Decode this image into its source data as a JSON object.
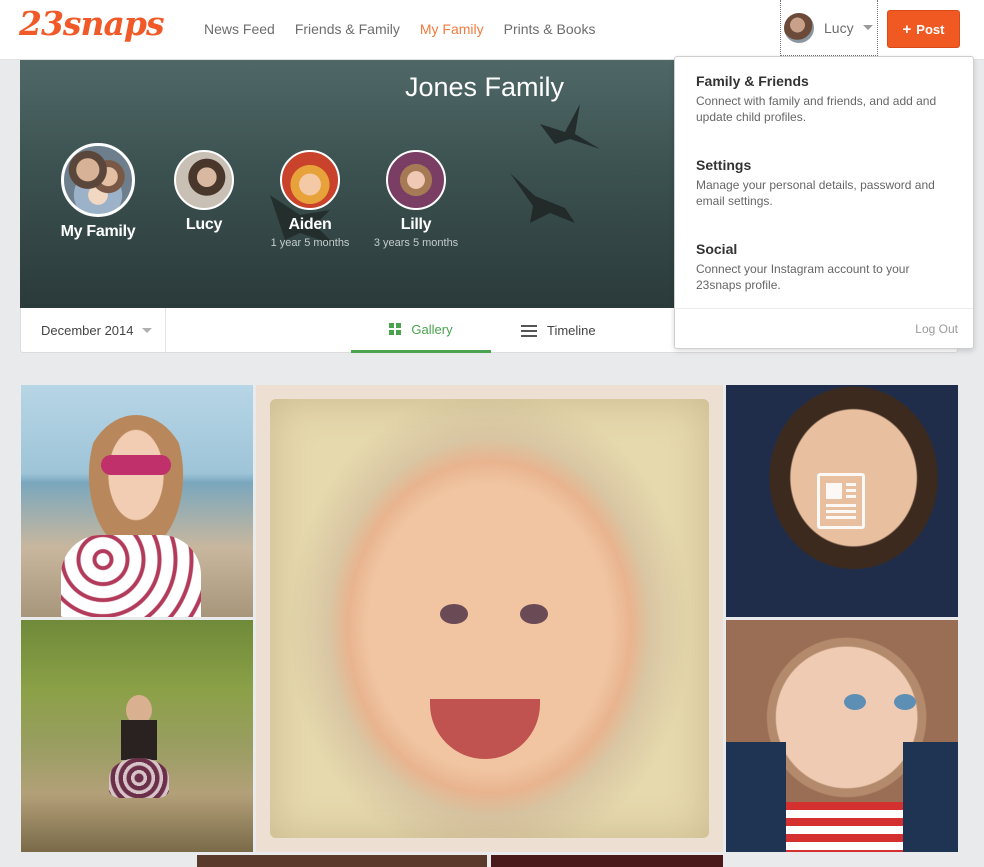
{
  "brand": {
    "logo": "23snaps",
    "accent": "#f05a22"
  },
  "nav": {
    "items": [
      {
        "label": "News Feed",
        "active": false
      },
      {
        "label": "Friends & Family",
        "active": false
      },
      {
        "label": "My Family",
        "active": true
      },
      {
        "label": "Prints & Books",
        "active": false
      }
    ]
  },
  "user": {
    "name": "Lucy"
  },
  "post_button": {
    "label": "Post",
    "icon": "plus-icon"
  },
  "hero": {
    "title": "Jones Family",
    "profiles": [
      {
        "name": "My Family",
        "age": ""
      },
      {
        "name": "Lucy",
        "age": ""
      },
      {
        "name": "Aiden",
        "age": "1 year 5 months"
      },
      {
        "name": "Lilly",
        "age": "3 years 5 months"
      }
    ]
  },
  "toolbar": {
    "month": "December 2014",
    "tabs": [
      {
        "label": "Gallery",
        "icon": "grid-icon",
        "active": true
      },
      {
        "label": "Timeline",
        "icon": "list-icon",
        "active": false
      }
    ]
  },
  "dropdown": {
    "items": [
      {
        "title": "Family & Friends",
        "description": "Connect with family and friends, and add and update child profiles."
      },
      {
        "title": "Settings",
        "description": "Manage your personal details, password and email settings."
      },
      {
        "title": "Social",
        "description": "Connect your Instagram account to your 23snaps profile."
      }
    ],
    "logout": "Log Out"
  },
  "colors": {
    "active_nav": "#f07b3f",
    "gallery_tab": "#4aa34f",
    "hero_bg": "#3b5150"
  }
}
